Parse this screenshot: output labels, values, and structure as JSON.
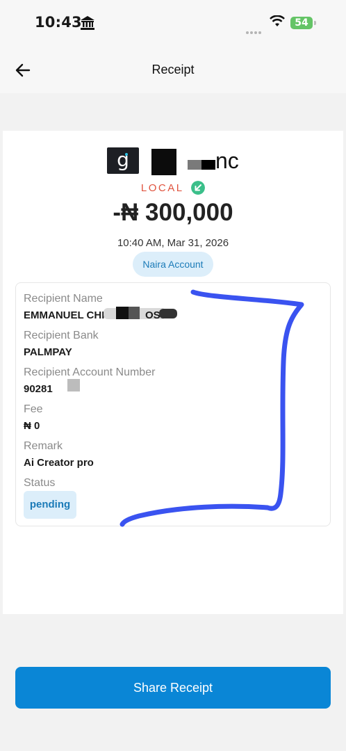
{
  "status_bar": {
    "time": "10:43",
    "battery": "54"
  },
  "header": {
    "title": "Receipt"
  },
  "receipt": {
    "merchant_name": "nc",
    "logo_letter": "g",
    "type_label": "LOCAL",
    "amount": "-₦ 300,000",
    "datetime": "10:40 AM, Mar 31, 2026",
    "account": "Naira Account",
    "fields": {
      "recipient_name_label": "Recipient Name",
      "recipient_name_value": "EMMANUEL CHI",
      "recipient_name_tail": "OS",
      "recipient_bank_label": "Recipient Bank",
      "recipient_bank_value": "PALMPAY",
      "account_number_label": "Recipient Account Number",
      "account_number_value": "90281",
      "fee_label": "Fee",
      "fee_value": "₦ 0",
      "remark_label": "Remark",
      "remark_value": "Ai Creator pro",
      "status_label": "Status",
      "status_value": "pending"
    }
  },
  "actions": {
    "share_label": "Share Receipt"
  },
  "colors": {
    "accent": "#0a86d6",
    "local": "#e0533e",
    "pill_bg": "#dceefa",
    "scribble": "#3a53f0"
  }
}
